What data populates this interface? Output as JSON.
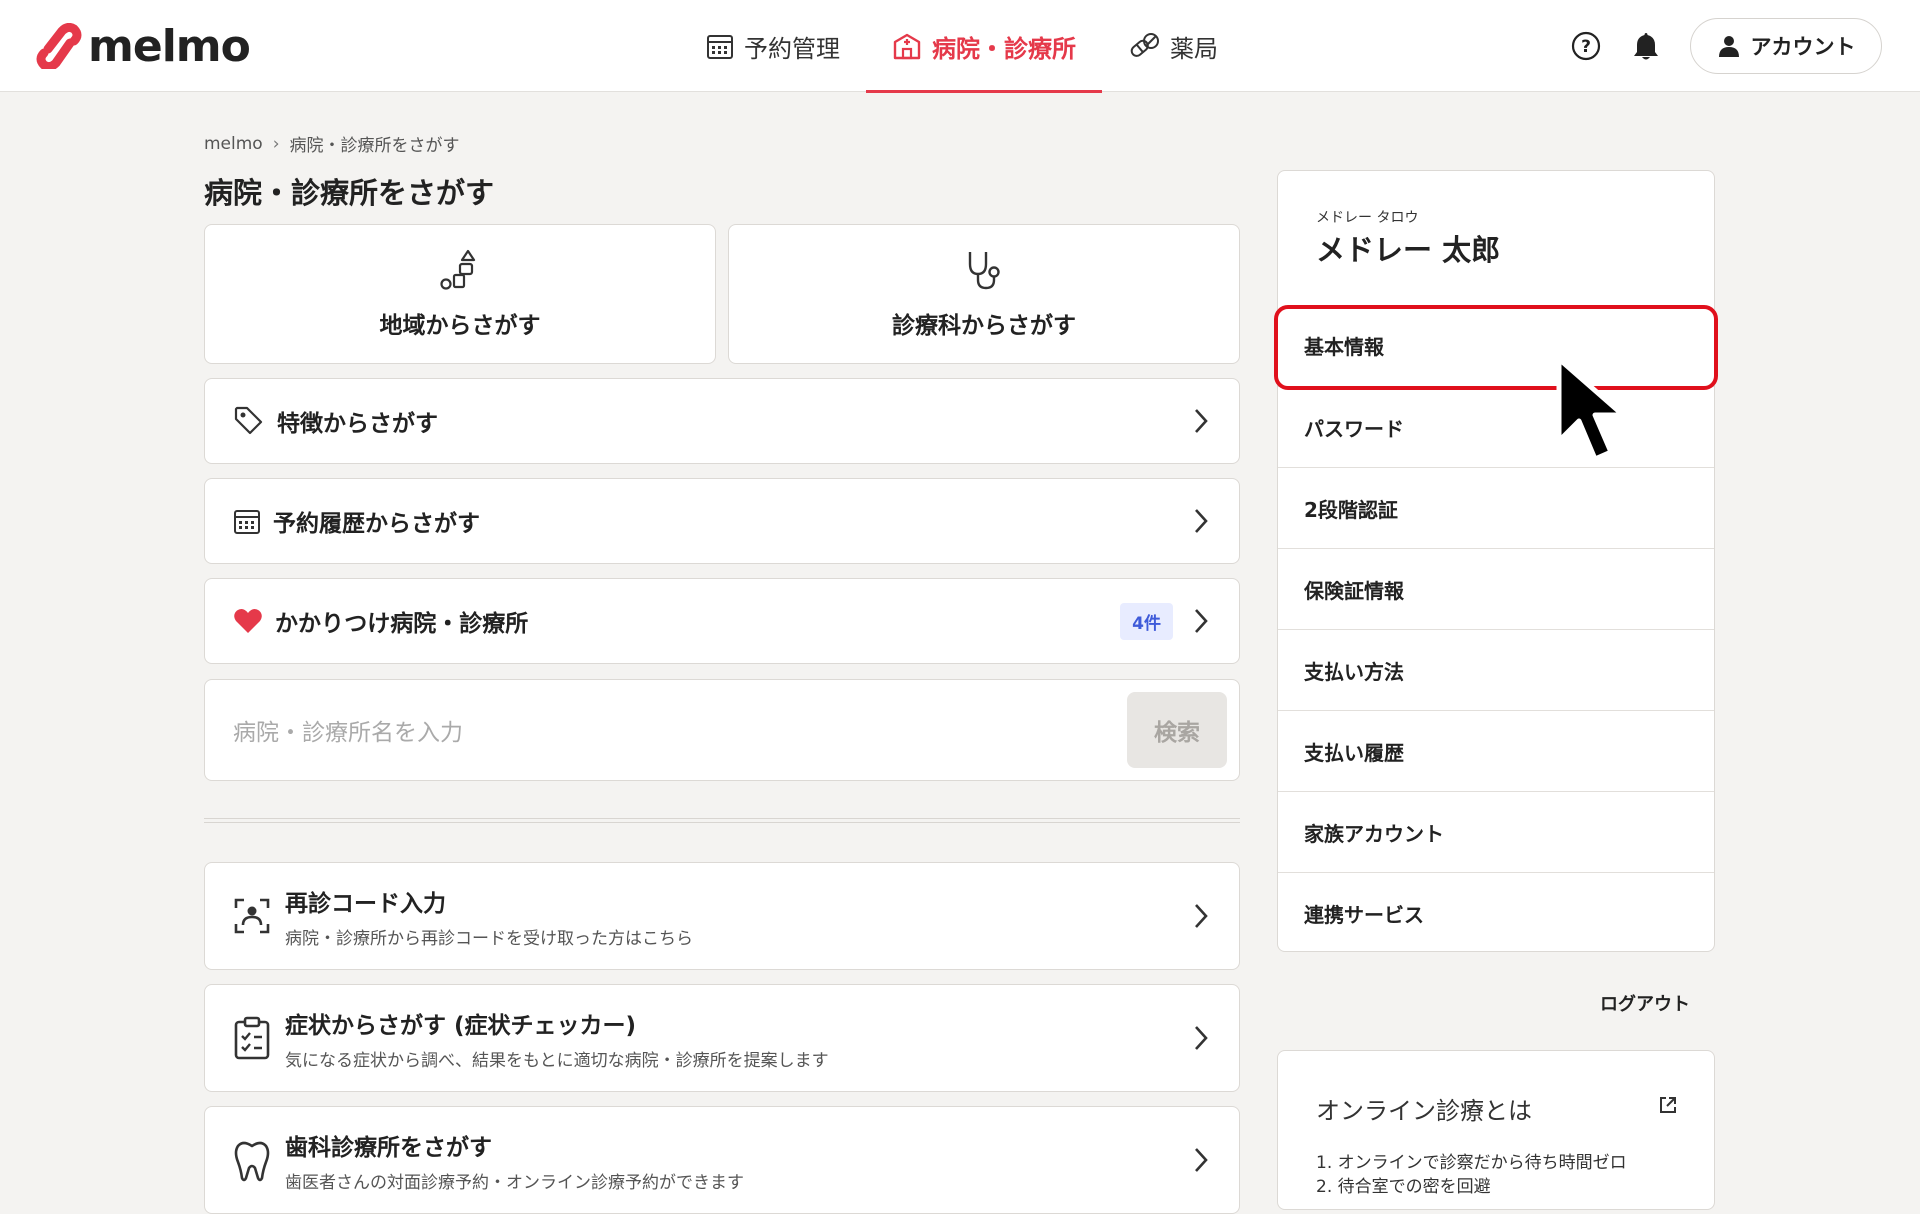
{
  "header": {
    "logo_text": "melmo",
    "nav": [
      {
        "label": "予約管理",
        "icon": "calendar-icon"
      },
      {
        "label": "病院・診療所",
        "icon": "hospital-icon"
      },
      {
        "label": "薬局",
        "icon": "pill-icon"
      }
    ],
    "account_label": "アカウント",
    "accent_color": "#e5394a"
  },
  "breadcrumb": {
    "home": "melmo",
    "current": "病院・診療所をさがす"
  },
  "page_title": "病院・診療所をさがす",
  "tiles": [
    {
      "label": "地域からさがす",
      "icon": "region-shapes-icon"
    },
    {
      "label": "診療科からさがす",
      "icon": "stethoscope-icon"
    }
  ],
  "rows": [
    {
      "label": "特徴からさがす",
      "icon": "tag-icon"
    },
    {
      "label": "予約履歴からさがす",
      "icon": "calendar-icon"
    },
    {
      "label": "かかりつけ病院・診療所",
      "icon": "heart-icon",
      "badge": "4件"
    }
  ],
  "search": {
    "placeholder": "病院・診療所名を入力",
    "button": "検索"
  },
  "big_rows": [
    {
      "title": "再診コード入力",
      "sub": "病院・診療所から再診コードを受け取った方はこちら",
      "icon": "face-scan-icon"
    },
    {
      "title": "症状からさがす (症状チェッカー)",
      "sub": "気になる症状から調べ、結果をもとに適切な病院・診療所を提案します",
      "icon": "clipboard-check-icon"
    },
    {
      "title": "歯科診療所をさがす",
      "sub": "歯医者さんの対面診療予約・オンライン診療予約ができます",
      "icon": "tooth-icon"
    }
  ],
  "sidebar": {
    "furigana": "メドレー タロウ",
    "name": "メドレー 太郎",
    "menu": [
      "基本情報",
      "パスワード",
      "2段階認証",
      "保険証情報",
      "支払い方法",
      "支払い履歴",
      "家族アカウント",
      "連携サービス"
    ],
    "logout": "ログアウト",
    "info_title": "オンライン診療とは",
    "info_items": [
      "1. オンラインで診察だから待ち時間ゼロ",
      "2. 待合室での密を回避"
    ]
  }
}
